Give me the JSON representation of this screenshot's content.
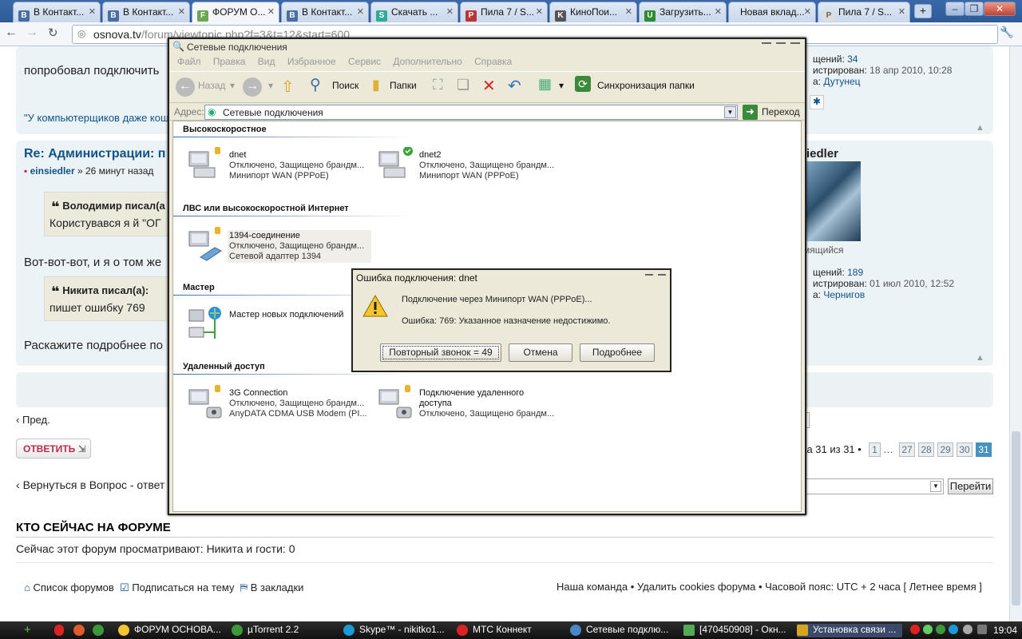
{
  "browser": {
    "tabs": [
      {
        "label": "В Контакт...",
        "fav": "B"
      },
      {
        "label": "В Контакт...",
        "fav": "B"
      },
      {
        "label": "ФОРУМ О...",
        "fav": "F"
      },
      {
        "label": "В Контакт...",
        "fav": "B"
      },
      {
        "label": "Скачать ...",
        "fav": "S"
      },
      {
        "label": "Пила 7 / S...",
        "fav": "P"
      },
      {
        "label": "КиноПои...",
        "fav": "K"
      },
      {
        "label": "Загрузить...",
        "fav": "U"
      },
      {
        "label": "Новая вклад...",
        "fav": ""
      },
      {
        "label": "Пила 7 / S...",
        "fav": "P"
      }
    ],
    "url_host": "osnova.tv",
    "url_path": "/forum/viewtopic.php?f=3&t=12&start=600"
  },
  "forum": {
    "post1_text": "попробовал подключить",
    "post1_signature": "\"У компьютерщиков даже кош",
    "post1_stats": {
      "posts_label": "щений:",
      "posts": "34",
      "reg_label": "истрирован:",
      "reg": "18 апр 2010, 10:28",
      "from_label": "а:",
      "from": "Дутунец"
    },
    "post2_title": "Re: Администрации: п",
    "post2_author": "einsiedler",
    "post2_time": "» 26 минут назад",
    "post2_author_right": "iedler",
    "post2_rank": "мящийся",
    "post2_stats": {
      "posts_label": "щений:",
      "posts": "189",
      "reg_label": "истрирован:",
      "reg": "01 июл 2010, 12:52",
      "from_label": "а:",
      "from": "Чернигов"
    },
    "quote1_head": "Володимир писал(а",
    "quote1_text": "Користувався я й \"ОГ",
    "mid_text": "Вот-вот-вот, и я о том же",
    "quote2_head": "Никита писал(а):",
    "quote2_text": "пишет ошибку 769",
    "last_text": "Раскажите подробнее по",
    "prev": "Пред.",
    "reply_btn": "ОТВЕТИТЬ",
    "pagination_text": "ца 31 из 31 •",
    "pages": [
      "1",
      "…",
      "27",
      "28",
      "29",
      "30",
      "31"
    ],
    "back_link": "Вернуться в Вопрос - ответ",
    "go_btn": "Перейти",
    "who_title": "КТО СЕЙЧАС НА ФОРУМЕ",
    "who_text": "Сейчас этот форум просматривают: Никита и гости: 0",
    "footer_left": [
      "Список форумов",
      "Подписаться на тему",
      "В закладки"
    ],
    "footer_right": "Наша команда • Удалить cookies форума • Часовой пояс: UTC + 2 часа [ Летнее время ]"
  },
  "explorer": {
    "title": "Сетевые подключения",
    "menu": [
      "Файл",
      "Правка",
      "Вид",
      "Избранное",
      "Сервис",
      "Дополнительно",
      "Справка"
    ],
    "toolbar": {
      "back": "Назад",
      "search": "Поиск",
      "folders": "Папки",
      "sync": "Синхронизация папки"
    },
    "address_label": "Адрес:",
    "address_value": "Сетевые подключения",
    "go_label": "Переход",
    "groups": [
      "Высокоскоростное",
      "ЛВС или высокоскоростной Интернет",
      "Мастер",
      "Удаленный доступ"
    ],
    "connections": [
      {
        "name": "dnet",
        "status": "Отключено, Защищено брандм...",
        "device": "Минипорт WAN (PPPoE)"
      },
      {
        "name": "dnet2",
        "status": "Отключено, Защищено брандм...",
        "device": "Минипорт WAN (PPPoE)"
      },
      {
        "name": "1394-соединение",
        "status": "Отключено, Защищено брандм...",
        "device": "Сетевой адаптер 1394"
      },
      {
        "name": "Мастер новых подключений",
        "status": "",
        "device": ""
      },
      {
        "name": "3G Connection",
        "status": "Отключено, Защищено брандм...",
        "device": "AnyDATA CDMA USB Modem (PI..."
      },
      {
        "name": "Подключение удаленного",
        "name2": "доступа",
        "status": "Отключено, Защищено брандм..."
      }
    ]
  },
  "dialog": {
    "title": "Ошибка подключения: dnet",
    "line1": "Подключение через Минипорт WAN (PPPoE)...",
    "line2": "Ошибка: 769: Указанное назначение недостижимо.",
    "btn_redial": "Повторный звонок = 49",
    "btn_cancel": "Отмена",
    "btn_details": "Подробнее"
  },
  "taskbar": {
    "items": [
      "ФОРУМ ОСНОВА...",
      "µTorrent 2.2",
      "Skype™ - nikitko1...",
      "МТС Коннект",
      "Сетевые подклю...",
      "[470450908] - Окн...",
      "Установка связи ..."
    ],
    "clock": "19:04"
  },
  "colors": {
    "accent": "#105289",
    "tabbar": "#2e5a97",
    "dialog_bg": "#ece9d8"
  }
}
